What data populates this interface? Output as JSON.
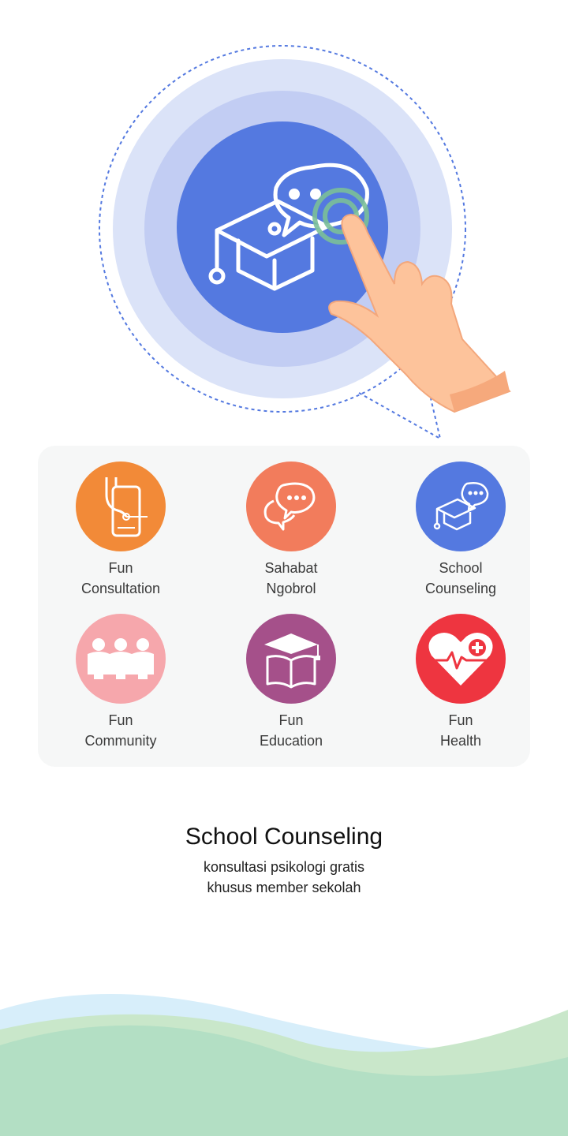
{
  "features": [
    {
      "line1": "Fun",
      "line2": "Consultation",
      "color": "#f28a38",
      "icon": "stethoscope-phone-icon"
    },
    {
      "line1": "Sahabat",
      "line2": "Ngobrol",
      "color": "#f27c5c",
      "icon": "chat-bubbles-icon"
    },
    {
      "line1": "School",
      "line2": "Counseling",
      "color": "#5479e0",
      "icon": "graduation-chat-icon"
    },
    {
      "line1": "Fun",
      "line2": "Community",
      "color": "#f6a7ac",
      "icon": "people-group-icon"
    },
    {
      "line1": "Fun",
      "line2": "Education",
      "color": "#a5508a",
      "icon": "book-cap-icon"
    },
    {
      "line1": "Fun",
      "line2": "Health",
      "color": "#ee3540",
      "icon": "heart-health-icon"
    }
  ],
  "info": {
    "title": "School Counseling",
    "line1": "konsultasi psikologi gratis",
    "line2": "khusus member sekolah"
  },
  "colors": {
    "accent": "#5479e0",
    "ring_inner": "#c2cdf3",
    "ring_outer": "#dbe3f8",
    "card_bg": "#f6f7f7",
    "wave_blue": "#d7eefa",
    "wave_green": "#b3dfc4"
  }
}
